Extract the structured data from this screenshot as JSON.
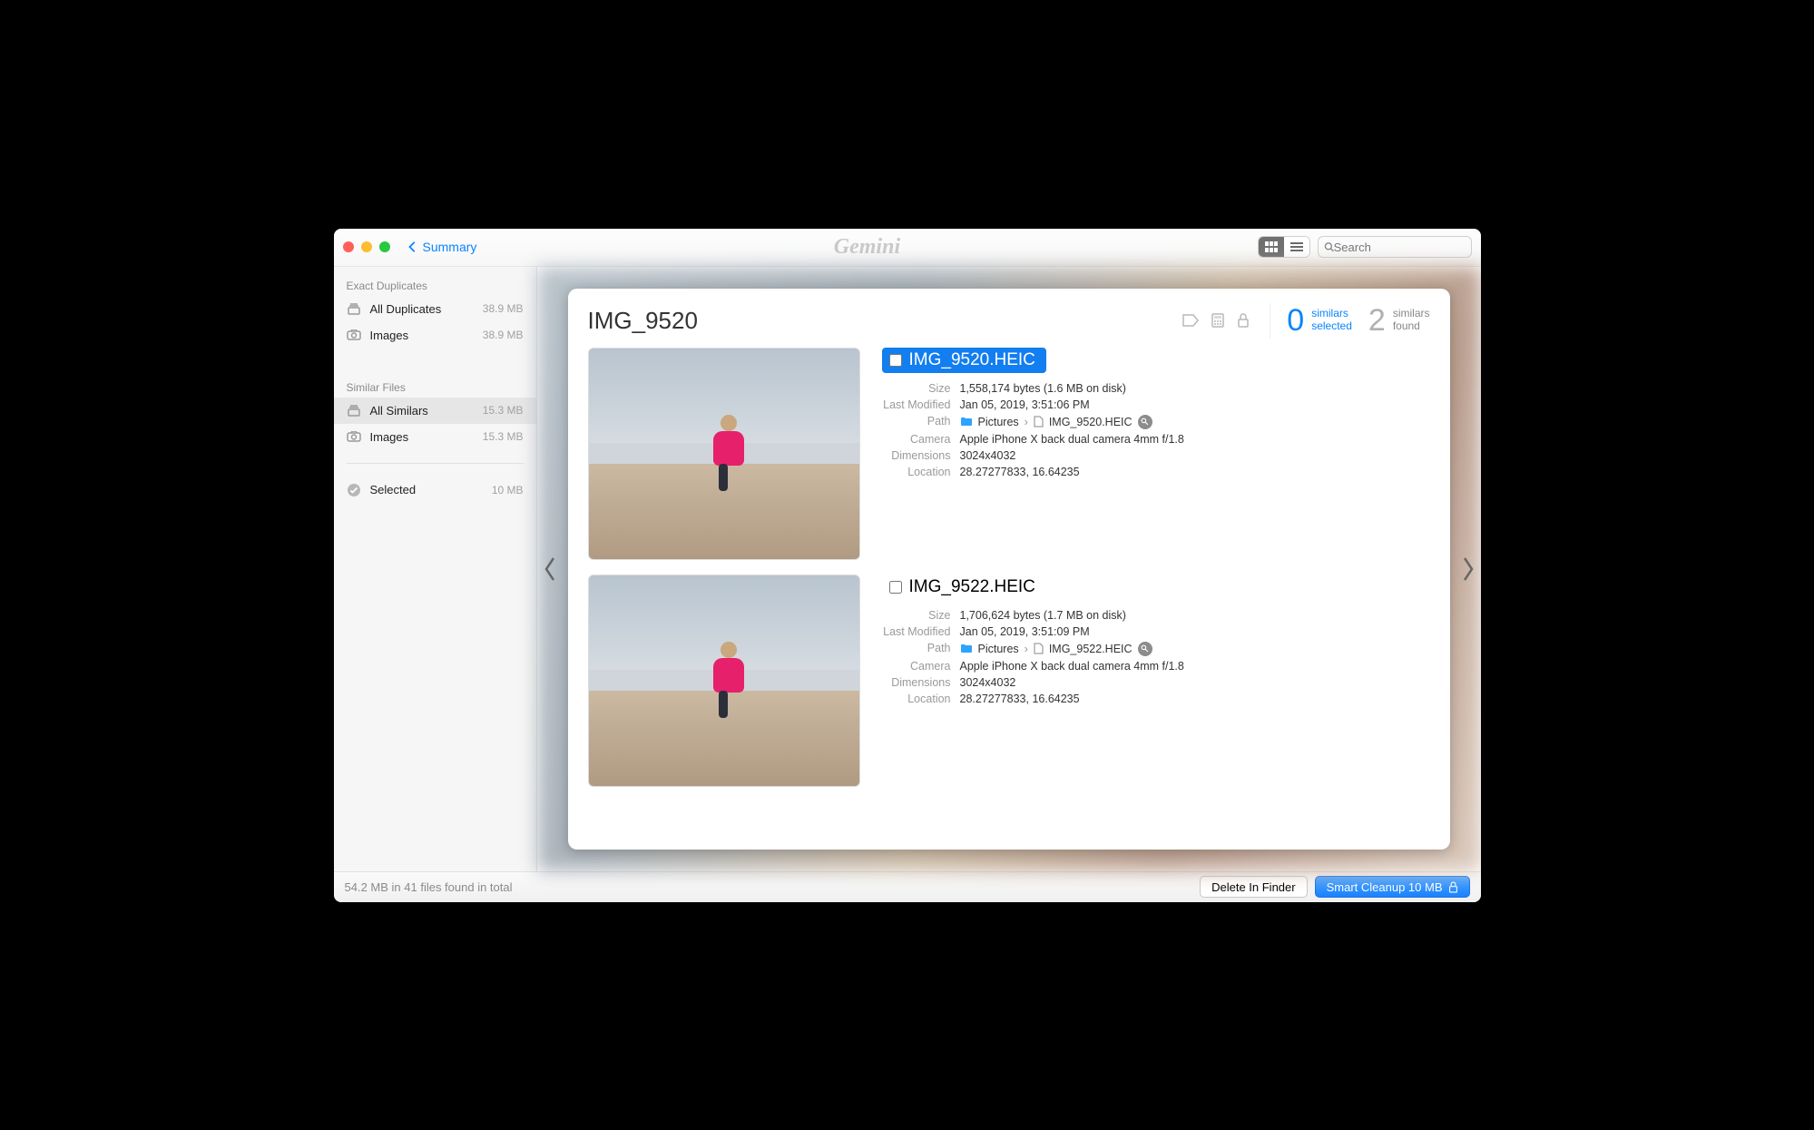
{
  "titlebar": {
    "back_label": "Summary",
    "app_name": "Gemini",
    "search_placeholder": "Search"
  },
  "sidebar": {
    "sections": [
      {
        "header": "Exact Duplicates",
        "items": [
          {
            "icon": "stack",
            "label": "All Duplicates",
            "size": "38.9 MB",
            "active": false
          },
          {
            "icon": "camera",
            "label": "Images",
            "size": "38.9 MB",
            "active": false
          }
        ]
      },
      {
        "header": "Similar Files",
        "items": [
          {
            "icon": "stack",
            "label": "All Similars",
            "size": "15.3 MB",
            "active": true
          },
          {
            "icon": "camera",
            "label": "Images",
            "size": "15.3 MB",
            "active": false
          }
        ]
      }
    ],
    "selected": {
      "label": "Selected",
      "size": "10 MB"
    }
  },
  "card": {
    "title": "IMG_9520",
    "similars_selected_num": "0",
    "similars_selected_l1": "similars",
    "similars_selected_l2": "selected",
    "similars_found_num": "2",
    "similars_found_l1": "similars",
    "similars_found_l2": "found",
    "labels": {
      "size": "Size",
      "last_modified": "Last Modified",
      "path": "Path",
      "camera": "Camera",
      "dimensions": "Dimensions",
      "location": "Location"
    },
    "items": [
      {
        "selected": true,
        "filename": "IMG_9520.HEIC",
        "size": "1,558,174 bytes (1.6 MB on disk)",
        "last_modified": "Jan 05, 2019, 3:51:06 PM",
        "path_folder": "Pictures",
        "path_sep": "›",
        "path_file": "IMG_9520.HEIC",
        "camera": "Apple iPhone X back dual camera 4mm f/1.8",
        "dimensions": "3024x4032",
        "location": "28.27277833, 16.64235"
      },
      {
        "selected": false,
        "filename": "IMG_9522.HEIC",
        "size": "1,706,624 bytes (1.7 MB on disk)",
        "last_modified": "Jan 05, 2019, 3:51:09 PM",
        "path_folder": "Pictures",
        "path_sep": "›",
        "path_file": "IMG_9522.HEIC",
        "camera": "Apple iPhone X back dual camera 4mm f/1.8",
        "dimensions": "3024x4032",
        "location": "28.27277833, 16.64235"
      }
    ]
  },
  "footer": {
    "status": "54.2 MB in 41 files found in total",
    "delete_label": "Delete In Finder",
    "cleanup_label": "Smart Cleanup 10 MB"
  }
}
